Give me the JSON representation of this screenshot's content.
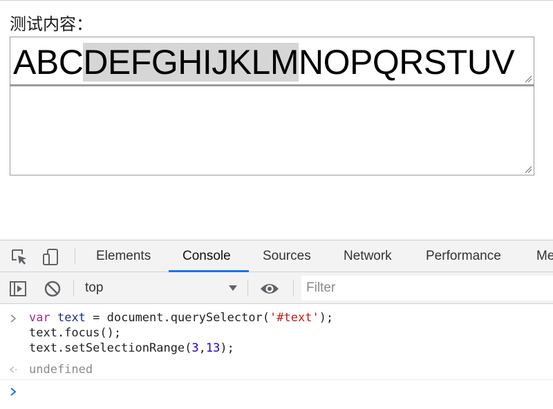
{
  "page": {
    "label": "测试内容：",
    "textarea_top": {
      "before": "ABC",
      "selected": "DEFGHIJKLM",
      "after": "NOPQRSTUV"
    },
    "textarea_bottom": {
      "value": ""
    }
  },
  "devtools": {
    "tabs": [
      {
        "label": "Elements"
      },
      {
        "label": "Console"
      },
      {
        "label": "Sources"
      },
      {
        "label": "Network"
      },
      {
        "label": "Performance"
      },
      {
        "label": "Me"
      }
    ],
    "active_tab": "Console",
    "toolbar": {
      "context": "top",
      "filter_placeholder": "Filter"
    },
    "console": {
      "input_lines": [
        "var text = document.querySelector('#text');",
        "text.focus();",
        "text.setSelectionRange(3,13);"
      ],
      "result": "undefined"
    },
    "colors": {
      "accent": "#1a73e8",
      "keyword": "#a8278f",
      "string": "#c41a16",
      "number": "#1c00cf",
      "selection": "#d6d6d6"
    }
  }
}
